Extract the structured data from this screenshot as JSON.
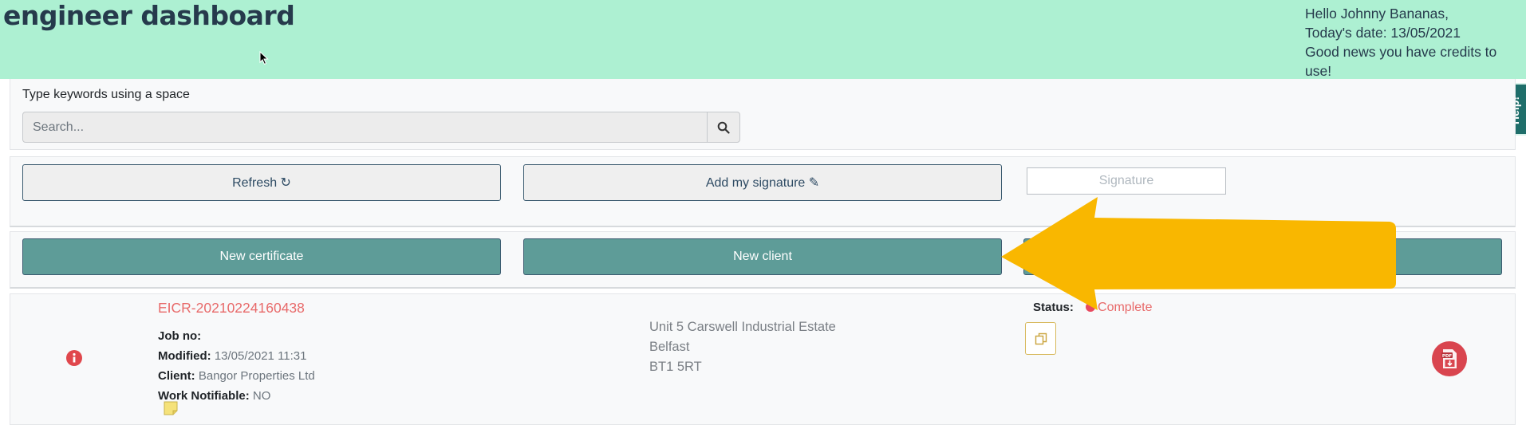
{
  "header": {
    "brand": "engineer dashboard",
    "greeting_line1": "Hello Johnny Bananas,",
    "greeting_line2": "Today's date: 13/05/2021",
    "greeting_line3": "Good news you have credits to use!"
  },
  "help_tab": {
    "label": "Help!"
  },
  "search": {
    "label": "Type keywords using a space",
    "placeholder": "Search...",
    "value": ""
  },
  "actions": {
    "refresh_label": "Refresh ↻",
    "add_signature_label": "Add my signature ✎",
    "signature_placeholder": "Signature"
  },
  "create": {
    "new_certificate_label": "New certificate",
    "new_client_label": "New client"
  },
  "record": {
    "cert_id": "EICR-20210224160438",
    "job_no_label": "Job no:",
    "job_no_value": "",
    "modified_label": "Modified:",
    "modified_value": "13/05/2021 11:31",
    "client_label": "Client:",
    "client_value": "Bangor Properties Ltd",
    "work_notifiable_label": "Work Notifiable:",
    "work_notifiable_value": "NO",
    "address_line1": "Unit 5 Carswell Industrial Estate",
    "address_line2": "Belfast",
    "address_line3": "BT1 5RT",
    "status_label": "Status:",
    "status_value": "Complete"
  },
  "icons": {
    "info": "info-icon",
    "note": "sticky-note-icon",
    "copy": "copy-icon",
    "pdf": "pdf-download-icon",
    "search": "search-icon"
  },
  "colors": {
    "header_bg": "#adf0d2",
    "teal_button": "#5e9c98",
    "accent_red": "#e86a6a",
    "annotation_arrow": "#f9b700"
  }
}
